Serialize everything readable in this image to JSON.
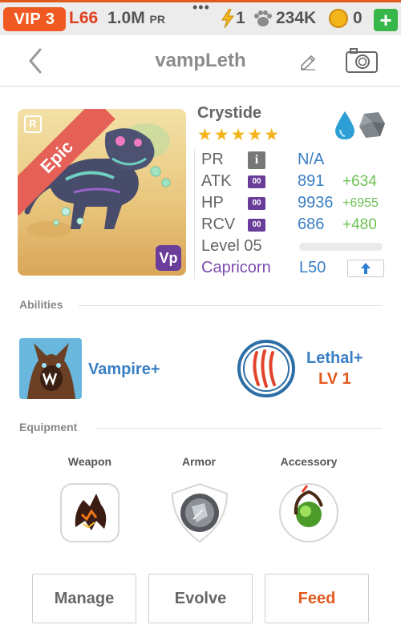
{
  "status_bar": {
    "vip": "VIP 3",
    "level": "L66",
    "power_value": "1.0M",
    "power_unit": "PR",
    "dots": "•••",
    "energy": "1",
    "gold": "234K",
    "coins": "0",
    "add_label": "+",
    "colors": {
      "vip": "#f05a22",
      "level": "#e0401f",
      "add": "#37b64a"
    }
  },
  "header": {
    "title": "vampLeth",
    "back_icon": "chevron-left-icon",
    "edit_icon": "pencil-icon",
    "camera_icon": "camera-icon"
  },
  "monster": {
    "name": "Crystide",
    "stars": "★★★★★",
    "rarity": "Epic",
    "rank_badge": "R",
    "corner_badge": "Vp",
    "elements": [
      "water-element-icon",
      "rock-element-icon"
    ],
    "stats": {
      "pr": {
        "label": "PR",
        "value": "N/A",
        "info": "i"
      },
      "atk": {
        "label": "ATK",
        "tag": "00",
        "value": "891",
        "bonus": "+634"
      },
      "hp": {
        "label": "HP",
        "tag": "00",
        "value": "9936",
        "bonus": "+6955"
      },
      "rcv": {
        "label": "RCV",
        "tag": "00",
        "value": "686",
        "bonus": "+480"
      }
    },
    "level_label": "Level 05",
    "level_progress": 0,
    "zodiac": "Capricorn",
    "zodiac_level": "L50"
  },
  "abilities": {
    "title": "Abilities",
    "items": [
      {
        "name": "Vampire+",
        "icon": "werewolf-icon"
      },
      {
        "name": "Lethal+",
        "level": "LV 1",
        "icon": "claw-slash-icon"
      }
    ]
  },
  "equipment": {
    "title": "Equipment",
    "slots": [
      {
        "label": "Weapon",
        "icon": "lava-claw-weapon-icon"
      },
      {
        "label": "Armor",
        "icon": "stone-shield-armor-icon"
      },
      {
        "label": "Accessory",
        "icon": "green-orb-accessory-icon"
      }
    ]
  },
  "actions": {
    "manage": "Manage",
    "evolve": "Evolve",
    "feed": "Feed"
  }
}
